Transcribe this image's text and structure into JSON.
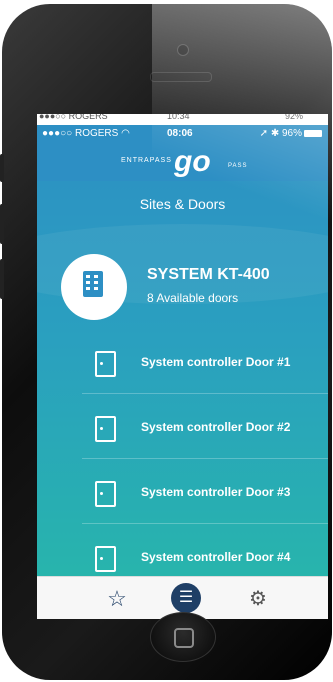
{
  "status_bar": {
    "back_carrier": "●●●○○ ROGERS ",
    "back_time": "10:34",
    "back_battery": "92%",
    "carrier": "●●●○○ ROGERS",
    "time": "08:06",
    "battery": "96%"
  },
  "header": {
    "logo_prefix": "ENTRAPASS",
    "logo_main": "go",
    "logo_suffix": "PASS"
  },
  "page": {
    "title": "Sites & Doors"
  },
  "site": {
    "name": "SYSTEM KT-400",
    "subtitle": "8 Available doors",
    "icon": "building-icon"
  },
  "doors": [
    {
      "label": "System controller Door #1",
      "icon": "door-icon"
    },
    {
      "label": "System controller Door #2",
      "icon": "door-icon"
    },
    {
      "label": "System controller Door #3",
      "icon": "door-icon"
    },
    {
      "label": "System controller Door #4",
      "icon": "door-icon"
    }
  ],
  "tabs": [
    {
      "name": "favorites",
      "icon": "star-icon",
      "glyph": "☆"
    },
    {
      "name": "list",
      "icon": "list-icon",
      "glyph": "☰"
    },
    {
      "name": "settings",
      "icon": "gear-icon",
      "glyph": "⚙"
    }
  ],
  "colors": {
    "primary_blue": "#2d8fc4",
    "teal": "#27b8a9",
    "tab_active": "#1f3f66"
  }
}
